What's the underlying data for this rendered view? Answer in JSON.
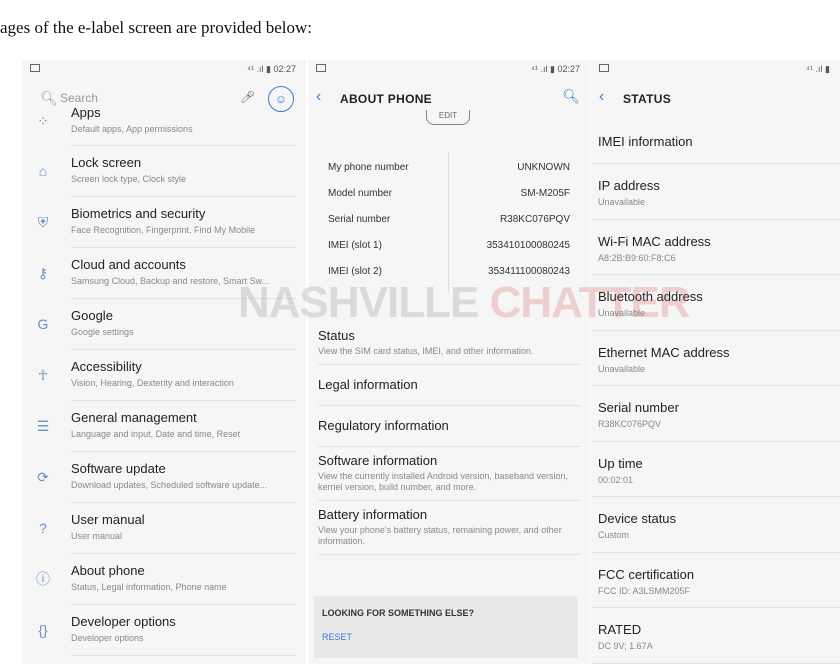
{
  "caption": "ages of the e-label screen are provided below:",
  "watermark": {
    "part1": "NASHVILLE ",
    "part2": "CHATTER"
  },
  "status_bar": {
    "signal": "📶",
    "time": "02:27",
    "right_text": "⁴¹ .ıl ▮ 02:27",
    "right_text_short": "⁴¹ .ıl ▮"
  },
  "screen1": {
    "search_placeholder": "Search",
    "items": [
      {
        "title": "Apps",
        "subtitle": "Default apps, App permissions",
        "icon": "apps-icon"
      },
      {
        "title": "Lock screen",
        "subtitle": "Screen lock type, Clock style",
        "icon": "lock-icon"
      },
      {
        "title": "Biometrics and security",
        "subtitle": "Face Recognition, Fingerprint, Find My Mobile",
        "icon": "shield-icon"
      },
      {
        "title": "Cloud and accounts",
        "subtitle": "Samsung Cloud, Backup and restore, Smart Sw...",
        "icon": "key-icon"
      },
      {
        "title": "Google",
        "subtitle": "Google settings",
        "icon": "google-icon"
      },
      {
        "title": "Accessibility",
        "subtitle": "Vision, Hearing, Dexterity and interaction",
        "icon": "accessibility-icon"
      },
      {
        "title": "General management",
        "subtitle": "Language and input, Date and time, Reset",
        "icon": "sliders-icon"
      },
      {
        "title": "Software update",
        "subtitle": "Download updates, Scheduled software update...",
        "icon": "update-icon"
      },
      {
        "title": "User manual",
        "subtitle": "User manual",
        "icon": "manual-icon"
      },
      {
        "title": "About phone",
        "subtitle": "Status, Legal information, Phone name",
        "icon": "info-icon"
      },
      {
        "title": "Developer options",
        "subtitle": "Developer options",
        "icon": "braces-icon"
      }
    ]
  },
  "screen2": {
    "title": "ABOUT PHONE",
    "edit_label": "EDIT",
    "info": [
      {
        "key": "My phone number",
        "value": "UNKNOWN"
      },
      {
        "key": "Model number",
        "value": "SM-M205F"
      },
      {
        "key": "Serial number",
        "value": "R38KC076PQV"
      },
      {
        "key": "IMEI (slot 1)",
        "value": "353410100080245"
      },
      {
        "key": "IMEI (slot 2)",
        "value": "353411100080243"
      }
    ],
    "items": [
      {
        "title": "Status",
        "subtitle": "View the SIM card status, IMEI, and other information."
      },
      {
        "title": "Legal information",
        "subtitle": ""
      },
      {
        "title": "Regulatory information",
        "subtitle": ""
      },
      {
        "title": "Software information",
        "subtitle": "View the currently installed Android version, baseband version, kernel version, build number, and more."
      },
      {
        "title": "Battery information",
        "subtitle": "View your phone's battery status, remaining power, and other information."
      }
    ],
    "looking_title": "LOOKING FOR SOMETHING ELSE?",
    "looking_reset": "RESET"
  },
  "screen3": {
    "title": "STATUS",
    "items": [
      {
        "title": "IMEI information",
        "subtitle": ""
      },
      {
        "title": "IP address",
        "subtitle": "Unavailable"
      },
      {
        "title": "Wi-Fi MAC address",
        "subtitle": "A8:2B:B9:60:F8:C6"
      },
      {
        "title": "Bluetooth address",
        "subtitle": "Unavailable"
      },
      {
        "title": "Ethernet MAC address",
        "subtitle": "Unavailable"
      },
      {
        "title": "Serial number",
        "subtitle": "R38KC076PQV"
      },
      {
        "title": "Up time",
        "subtitle": "00:02:01"
      },
      {
        "title": "Device status",
        "subtitle": "Custom"
      },
      {
        "title": "FCC certification",
        "subtitle": "FCC ID: A3LSMM205F"
      },
      {
        "title": "RATED",
        "subtitle": "DC 9V; 1.67A"
      }
    ]
  }
}
